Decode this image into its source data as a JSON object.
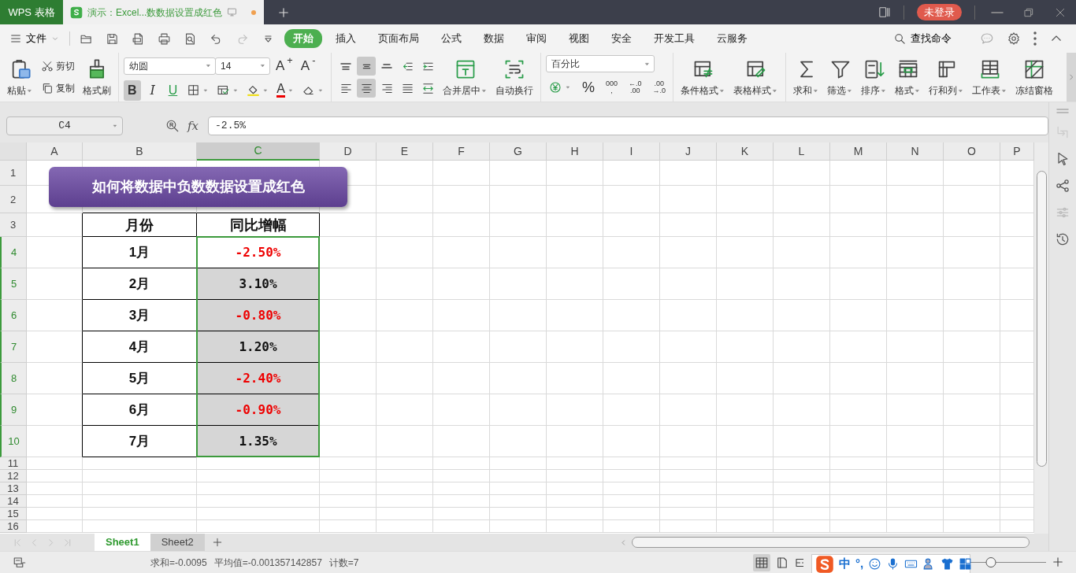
{
  "title_bar": {
    "app_tab": "WPS 表格",
    "document_tab": {
      "title": "演示：Excel...数数据设置成红色",
      "unsaved": true
    },
    "login_button": "未登录"
  },
  "menu_bar": {
    "file_menu": "文件",
    "tabs": [
      {
        "label": "开始",
        "selected": true
      },
      {
        "label": "插入",
        "selected": false
      },
      {
        "label": "页面布局",
        "selected": false
      },
      {
        "label": "公式",
        "selected": false
      },
      {
        "label": "数据",
        "selected": false
      },
      {
        "label": "审阅",
        "selected": false
      },
      {
        "label": "视图",
        "selected": false
      },
      {
        "label": "安全",
        "selected": false
      },
      {
        "label": "开发工具",
        "selected": false
      },
      {
        "label": "云服务",
        "selected": false
      }
    ],
    "search": "查找命令"
  },
  "ribbon": {
    "clipboard": [
      {
        "kind": "cut",
        "label": "剪切"
      },
      {
        "kind": "paste",
        "label": "粘贴",
        "dropdown": true
      },
      {
        "kind": "copy",
        "label": "复制"
      },
      {
        "kind": "painter",
        "label": "格式刷"
      }
    ],
    "font_name": "幼圆",
    "font_size": "14",
    "size_buttons": [
      "A$^{+}$",
      "A$^{-}$"
    ],
    "style_buttons": [
      {
        "kind": "bold",
        "label": "B",
        "on": true
      },
      {
        "kind": "italic",
        "label": "I",
        "on": false
      },
      {
        "kind": "underline",
        "label": "U",
        "on": false
      }
    ],
    "font_color_label": "A",
    "align_buttons": [
      {
        "kind": "top",
        "on": false
      },
      {
        "kind": "middle",
        "on": true
      },
      {
        "kind": "bottom",
        "on": false
      },
      {
        "kind": "outdent",
        "on": false
      },
      {
        "kind": "indent",
        "on": false
      },
      {
        "kind": "left",
        "on": false
      },
      {
        "kind": "center",
        "on": true
      },
      {
        "kind": "right",
        "on": false
      },
      {
        "kind": "justify",
        "on": false
      },
      {
        "kind": "distributed",
        "on": false
      }
    ],
    "merge_buttons": [
      {
        "kind": "merge",
        "label": "合并居中",
        "dropdown": true
      },
      {
        "kind": "wrap",
        "label": "自动换行",
        "dropdown": false
      }
    ],
    "number_format": "百分比",
    "number_buttons": [
      {
        "kind": "currency"
      },
      {
        "kind": "text",
        "label": "%"
      },
      {
        "kind": "stack",
        "lines": [
          "000",
          ","
        ]
      },
      {
        "kind": "stack",
        "lines": [
          "←.0",
          ".00"
        ]
      },
      {
        "kind": "stack",
        "lines": [
          ".00",
          "→.0"
        ]
      }
    ],
    "style_tools": [
      {
        "kind": "conditional",
        "label": "条件格式",
        "dropdown": true
      },
      {
        "kind": "tablestyle",
        "label": "表格样式",
        "dropdown": true
      }
    ],
    "edit_tools": [
      {
        "kind": "sum",
        "label": "求和",
        "dropdown": true
      },
      {
        "kind": "filter",
        "label": "筛选",
        "dropdown": true
      },
      {
        "kind": "sort",
        "label": "排序",
        "dropdown": true
      },
      {
        "kind": "format",
        "label": "格式",
        "dropdown": true
      },
      {
        "kind": "rowscols",
        "label": "行和列",
        "dropdown": true
      },
      {
        "kind": "sheet",
        "label": "工作表",
        "dropdown": true
      },
      {
        "kind": "freeze",
        "label": "冻结窗格",
        "dropdown": false
      }
    ]
  },
  "formula_bar": {
    "name_box": "C4",
    "function_label": "fx",
    "formula": "-2.5%"
  },
  "sheet": {
    "columns": [
      {
        "label": "A",
        "selected": false
      },
      {
        "label": "B",
        "selected": false
      },
      {
        "label": "C",
        "selected": true
      },
      {
        "label": "D",
        "selected": false
      },
      {
        "label": "E",
        "selected": false
      },
      {
        "label": "F",
        "selected": false
      },
      {
        "label": "G",
        "selected": false
      },
      {
        "label": "H",
        "selected": false
      },
      {
        "label": "I",
        "selected": false
      },
      {
        "label": "J",
        "selected": false
      },
      {
        "label": "K",
        "selected": false
      },
      {
        "label": "L",
        "selected": false
      },
      {
        "label": "M",
        "selected": false
      },
      {
        "label": "N",
        "selected": false
      },
      {
        "label": "O",
        "selected": false
      },
      {
        "label": "P",
        "selected": false
      }
    ],
    "rows": [
      {
        "label": "1",
        "selected": false
      },
      {
        "label": "2",
        "selected": false
      },
      {
        "label": "3",
        "selected": false
      },
      {
        "label": "4",
        "selected": true
      },
      {
        "label": "5",
        "selected": true
      },
      {
        "label": "6",
        "selected": true
      },
      {
        "label": "7",
        "selected": true
      },
      {
        "label": "8",
        "selected": true
      },
      {
        "label": "9",
        "selected": true
      },
      {
        "label": "10",
        "selected": true
      },
      {
        "label": "11",
        "selected": false
      },
      {
        "label": "12",
        "selected": false
      },
      {
        "label": "13",
        "selected": false
      },
      {
        "label": "14",
        "selected": false
      },
      {
        "label": "15",
        "selected": false
      },
      {
        "label": "16",
        "selected": false
      }
    ],
    "banner": "如何将数据中负数数据设置成红色",
    "table": {
      "header": [
        "月份",
        "同比增幅"
      ],
      "rows": [
        {
          "month": "1月",
          "change": "-2.50%",
          "negative": true,
          "selected": true,
          "active": true
        },
        {
          "month": "2月",
          "change": "3.10%",
          "negative": false,
          "selected": true,
          "active": false
        },
        {
          "month": "3月",
          "change": "-0.80%",
          "negative": true,
          "selected": true,
          "active": false
        },
        {
          "month": "4月",
          "change": "1.20%",
          "negative": false,
          "selected": true,
          "active": false
        },
        {
          "month": "5月",
          "change": "-2.40%",
          "negative": true,
          "selected": true,
          "active": false
        },
        {
          "month": "6月",
          "change": "-0.90%",
          "negative": true,
          "selected": true,
          "active": false
        },
        {
          "month": "7月",
          "change": "1.35%",
          "negative": false,
          "selected": true,
          "active": false
        }
      ]
    }
  },
  "sheet_tabs": [
    {
      "label": "Sheet1",
      "selected": true
    },
    {
      "label": "Sheet2",
      "selected": false
    }
  ],
  "status_bar": {
    "stats": [
      "求和=-0.0095",
      "平均值=-0.001357142857",
      "计数=7"
    ],
    "zoom": {
      "level": 0.27
    }
  },
  "ime_bar": {
    "labels": [
      "中",
      "°,"
    ]
  }
}
